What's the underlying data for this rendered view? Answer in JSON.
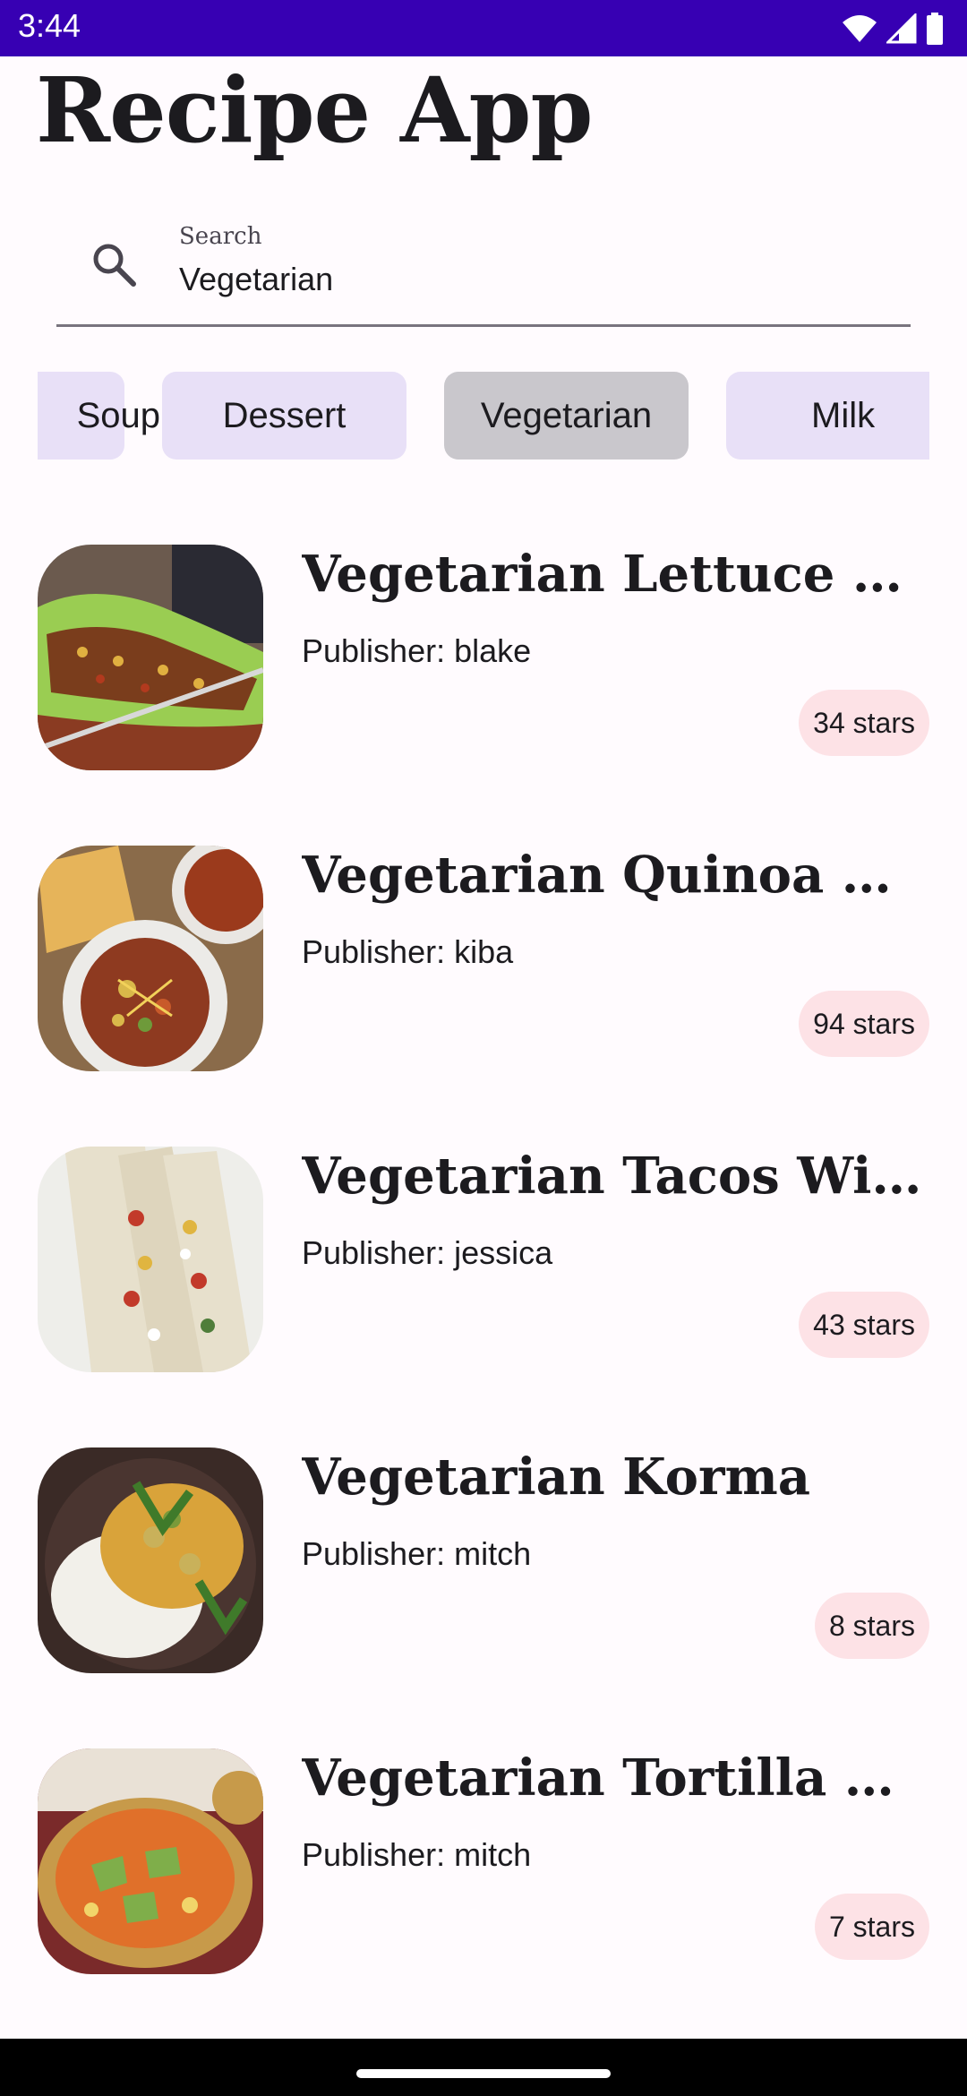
{
  "status_bar": {
    "time": "3:44"
  },
  "app": {
    "title": "Recipe App"
  },
  "search": {
    "label": "Search",
    "value": "Vegetarian"
  },
  "chips": [
    {
      "label": "Soup",
      "selected": false
    },
    {
      "label": "Dessert",
      "selected": false
    },
    {
      "label": "Vegetarian",
      "selected": true
    },
    {
      "label": "Milk",
      "selected": false
    }
  ],
  "recipes": [
    {
      "title": "Vegetarian Lettuce Wraps",
      "publisher": "Publisher: blake",
      "stars": "34 stars"
    },
    {
      "title": "Vegetarian Quinoa Chili",
      "publisher": "Publisher: kiba",
      "stars": "94 stars"
    },
    {
      "title": "Vegetarian Tacos With Corn Salsa",
      "publisher": "Publisher: jessica",
      "stars": "43 stars"
    },
    {
      "title": "Vegetarian Korma",
      "publisher": "Publisher: mitch",
      "stars": "8 stars"
    },
    {
      "title": "Vegetarian Tortilla Soup",
      "publisher": "Publisher: mitch",
      "stars": "7 stars"
    }
  ],
  "colors": {
    "status_bar": "#3700b3",
    "background": "#fffbfe",
    "chip": "#e8e0f7",
    "chip_selected": "#c9c7cc",
    "stars_badge": "#fde2e6"
  },
  "icons": {
    "wifi": "wifi-icon",
    "signal": "signal-icon",
    "battery": "battery-icon",
    "search": "search-icon"
  }
}
